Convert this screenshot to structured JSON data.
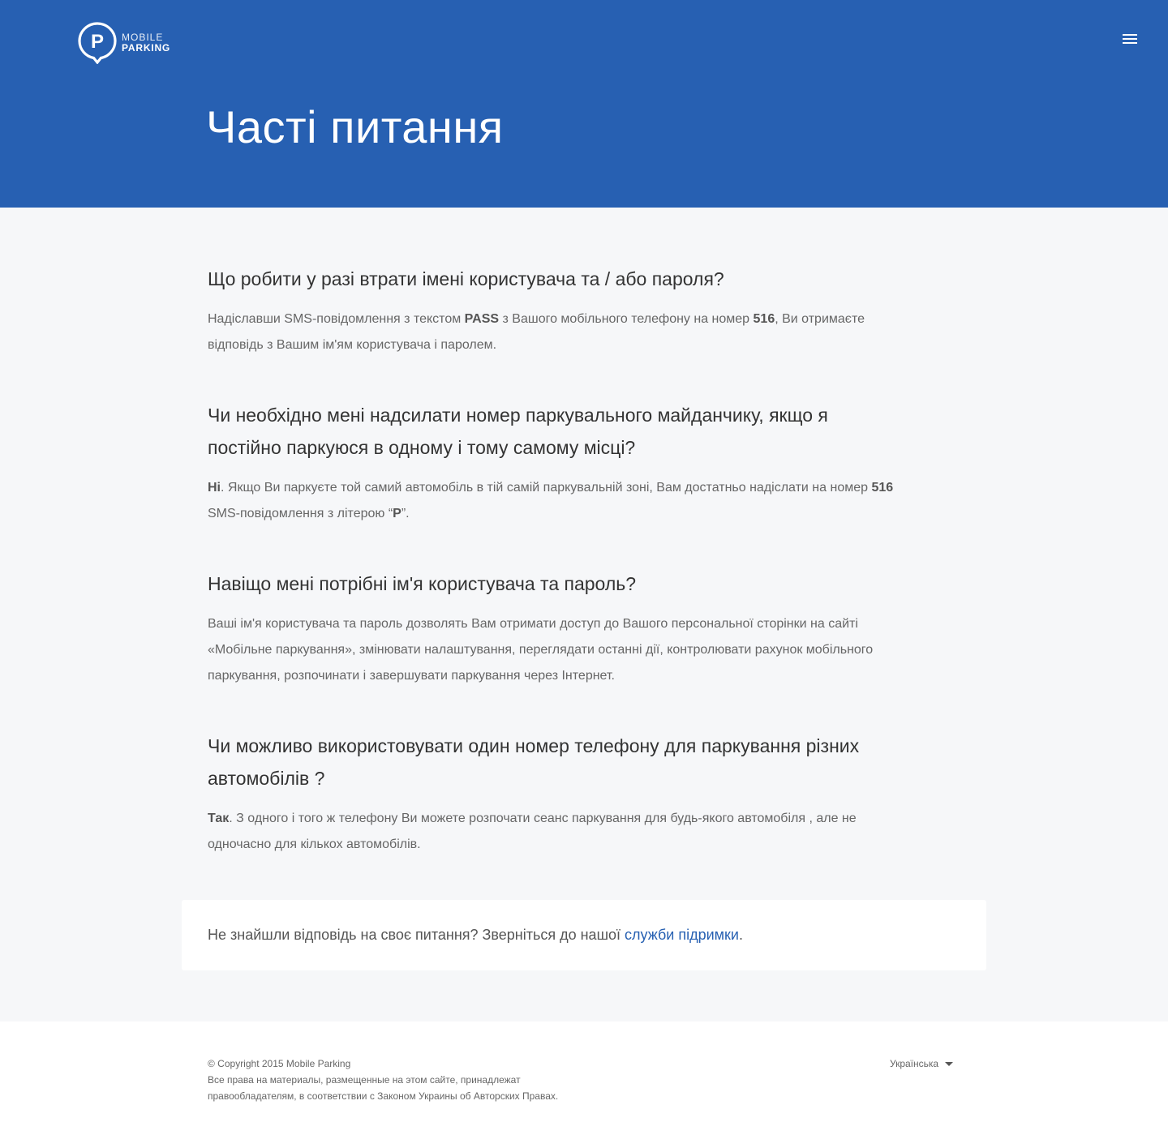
{
  "header": {
    "logo_line1": "MOBILE",
    "logo_line2": "PARKING",
    "logo_letter": "P",
    "menu_icon": "hamburger-menu-icon",
    "title": "Часті питання",
    "bg_color": "#2760b2"
  },
  "faq": [
    {
      "question": "Що робити у разі втрати імені користувача та / або пароля?",
      "answer_parts": [
        {
          "t": "Надіславши SMS-повідомлення з текстом ",
          "b": false
        },
        {
          "t": "PASS",
          "b": true
        },
        {
          "t": " з Вашого мобільного телефону на номер ",
          "b": false
        },
        {
          "t": "516",
          "b": true
        },
        {
          "t": ", Ви отримаєте відповідь з Вашим ім'ям користувача і паролем.",
          "b": false
        }
      ]
    },
    {
      "question": "Чи необхідно мені надсилати номер паркувального майданчику, якщо я постійно паркуюся в одному і тому самому місці?",
      "answer_parts": [
        {
          "t": "Ні",
          "b": true
        },
        {
          "t": ". Якщо Ви паркуєте той самий автомобіль в тій самій паркувальній зоні, Вам достатньо надіслати на номер ",
          "b": false
        },
        {
          "t": "516",
          "b": true
        },
        {
          "t": " SMS-повідомлення з літерою “",
          "b": false
        },
        {
          "t": "P",
          "b": true
        },
        {
          "t": "”.",
          "b": false
        }
      ]
    },
    {
      "question": "Навіщо мені потрібні ім'я користувача та пароль?",
      "answer_parts": [
        {
          "t": "Ваші ім'я користувача та пароль дозволять Вам отримати доступ до Вашого персональної сторінки на сайті «Мобільне паркування», змінювати налаштування, переглядати останні дії, контролювати рахунок мобільного паркування, розпочинати і завершувати паркування через Інтернет.",
          "b": false
        }
      ]
    },
    {
      "question": "Чи можливо використовувати один номер телефону для паркування різних автомобілів ?",
      "answer_parts": [
        {
          "t": "Так",
          "b": true
        },
        {
          "t": ". З одного і того ж телефону Ви можете розпочати сеанс паркування для будь-якого автомобіля , але не одночасно для кількох автомобілів.",
          "b": false
        }
      ]
    }
  ],
  "support": {
    "text": "Не знайшли відповідь на своє питання? Зверніться до нашої ",
    "link_label": "служби підримки",
    "suffix": ".",
    "link_color": "#2760b2"
  },
  "footer": {
    "copyright": "© Copyright 2015 Mobile Parking",
    "rights_line1": "Все права на материалы, размещенные на этом сайте, принадлежат",
    "rights_line2": "правообладателям, в соответствии с Законом Украины об Авторских Правах.",
    "language": "Українська",
    "language_icon": "caret-down-icon"
  }
}
